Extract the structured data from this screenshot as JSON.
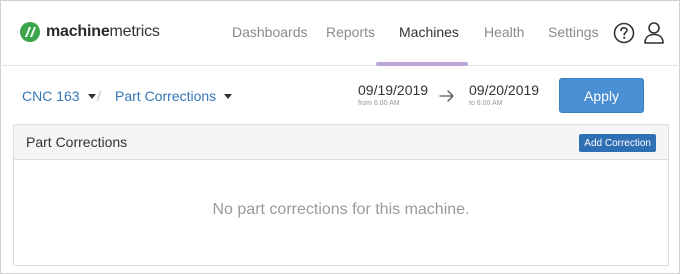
{
  "brand": {
    "name_bold": "machine",
    "name_rest": "metrics"
  },
  "nav": {
    "items": [
      {
        "label": "Dashboards"
      },
      {
        "label": "Reports"
      },
      {
        "label": "Machines"
      },
      {
        "label": "Health"
      },
      {
        "label": "Settings"
      }
    ],
    "active": "Machines",
    "help_icon": "question-circle-icon",
    "user_icon": "user-icon"
  },
  "filters": {
    "machine": "CNC 163",
    "separator": "/",
    "view": "Part Corrections",
    "start_date": "09/19/2019",
    "start_sub": "from 6:00 AM",
    "end_date": "09/20/2019",
    "end_sub": "to 6:00 AM",
    "apply_label": "Apply"
  },
  "panel": {
    "title": "Part Corrections",
    "add_label": "Add Correction",
    "empty_message": "No part corrections for this machine."
  },
  "colors": {
    "link": "#3677b8",
    "primary_button": "#4a8fd4",
    "add_button": "#2f6fb3",
    "nav_active_underline": "#b9a6d8",
    "logo_green": "#3aa54a"
  }
}
